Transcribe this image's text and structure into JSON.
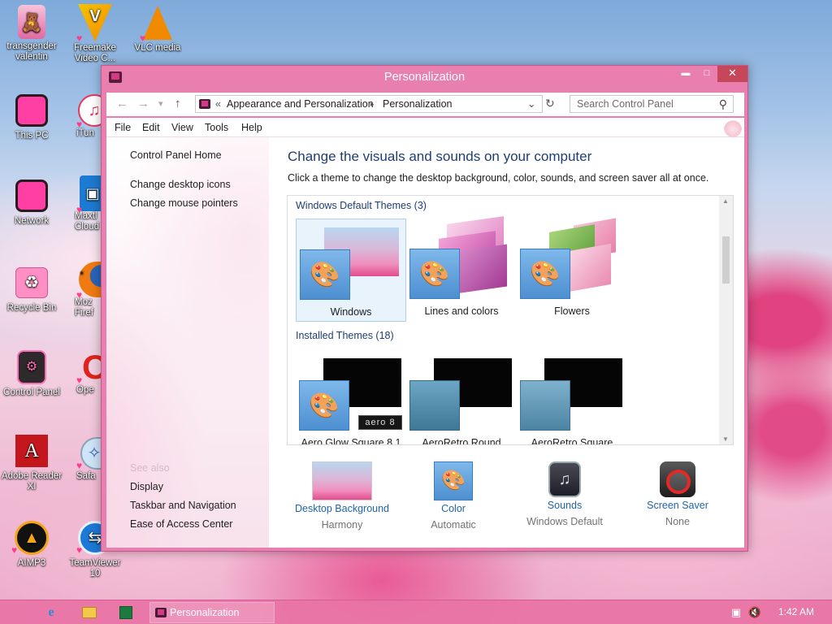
{
  "desktop": {
    "icons": [
      {
        "label": "transgender valentin",
        "glyph": "🧸"
      },
      {
        "label": "Freemake Video C...",
        "glyph": "V"
      },
      {
        "label": "VLC media",
        "glyph": "▲"
      },
      {
        "label": "This PC",
        "glyph": "▢"
      },
      {
        "label": "iTun",
        "glyph": "♫"
      },
      {
        "label": "Network",
        "glyph": "▢"
      },
      {
        "label": "Maxtl Cloud",
        "glyph": "▣"
      },
      {
        "label": "Recycle Bin",
        "glyph": "♻"
      },
      {
        "label": "Moz Firef",
        "glyph": "◉"
      },
      {
        "label": "Control Panel",
        "glyph": "⚙"
      },
      {
        "label": "Ope",
        "glyph": "O"
      },
      {
        "label": "Adobe Reader XI",
        "glyph": "A"
      },
      {
        "label": "Safa",
        "glyph": "✧"
      },
      {
        "label": "AIMP3",
        "glyph": "▲"
      },
      {
        "label": "TeamViewer 10",
        "glyph": "⇆"
      }
    ]
  },
  "window": {
    "title": "Personalization",
    "controls": {
      "minimize": "▬",
      "maximize": "□",
      "close": "✕"
    },
    "nav": {
      "back": "←",
      "forward": "→",
      "recent": "▾",
      "up": "↑",
      "breadcrumb_prefix": "«",
      "breadcrumb": [
        "Appearance and Personalization",
        "Personalization"
      ],
      "separator": "▸",
      "dropdown": "⌄",
      "refresh": "↻",
      "search_placeholder": "Search Control Panel",
      "search_icon": "⚲"
    },
    "menu": [
      "File",
      "Edit",
      "View",
      "Tools",
      "Help"
    ],
    "left_pane": {
      "home": "Control Panel Home",
      "links": [
        "Change desktop icons",
        "Change mouse pointers"
      ],
      "see_also_title": "See also",
      "see_also": [
        "Display",
        "Taskbar and Navigation",
        "Ease of Access Center"
      ]
    },
    "main": {
      "heading": "Change the visuals and sounds on your computer",
      "subheading": "Click a theme to change the desktop background, color, sounds, and screen saver all at once.",
      "groups": [
        {
          "title": "Windows Default Themes (3)",
          "themes": [
            "Windows",
            "Lines and colors",
            "Flowers"
          ]
        },
        {
          "title": "Installed Themes (18)",
          "themes": [
            "Aero Glow Square 8.1",
            "AeroRetro Round",
            "AeroRetro Square"
          ]
        }
      ],
      "aero_badge": "aero 8"
    },
    "bottom": [
      {
        "link": "Desktop Background",
        "value": "Harmony"
      },
      {
        "link": "Color",
        "value": "Automatic"
      },
      {
        "link": "Sounds",
        "value": "Windows Default"
      },
      {
        "link": "Screen Saver",
        "value": "None"
      }
    ]
  },
  "taskbar": {
    "active_window": "Personalization",
    "time": "1:42 AM"
  },
  "colors": {
    "accent": "#e97fae",
    "link": "#1e64a8",
    "heading": "#1e3e72"
  }
}
